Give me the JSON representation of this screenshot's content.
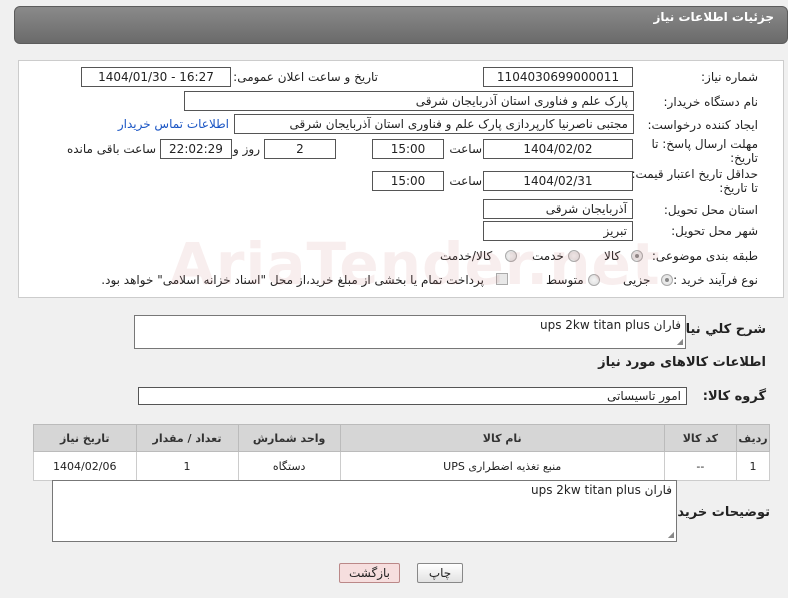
{
  "header": {
    "title": "جزئیات اطلاعات نیاز"
  },
  "form": {
    "need_number": {
      "label": "شماره نیاز:",
      "value": "1104030699000011"
    },
    "announce_datetime": {
      "label": "تاریخ و ساعت اعلان عمومی:",
      "value": "1404/01/30 - 16:27"
    },
    "buyer_org": {
      "label": "نام دستگاه خریدار:",
      "value": "پارک علم و فناوری استان آذربایجان شرقی"
    },
    "requester": {
      "label": "ایجاد کننده درخواست:",
      "value": "مجتبی ناصرنیا کارپردازی پارک علم و فناوری استان آذربایجان شرقی",
      "contact_link": "اطلاعات تماس خریدار"
    },
    "response_deadline": {
      "label_line1": "مهلت ارسال پاسخ: تا",
      "label_line2": "تاریخ:",
      "date": "1404/02/02",
      "time_label": "ساعت",
      "time": "15:00",
      "days": "2",
      "days_label": "روز و",
      "remaining": "22:02:29",
      "remaining_label": "ساعت باقی مانده"
    },
    "price_validity": {
      "label_line1": "حداقل تاریخ اعتبار قیمت:",
      "label_line2": "تا تاریخ:",
      "date": "1404/02/31",
      "time_label": "ساعت",
      "time": "15:00"
    },
    "delivery_province": {
      "label": "استان محل تحویل:",
      "value": "آذربایجان شرقی"
    },
    "delivery_city": {
      "label": "شهر محل تحویل:",
      "value": "تبریز"
    },
    "category": {
      "label": "طبقه بندی موضوعی:",
      "options": [
        "کالا",
        "خدمت",
        "کالا/خدمت"
      ],
      "selected": "کالا"
    },
    "process_type": {
      "label": "نوع فرآیند خرید :",
      "options": [
        "جزیی",
        "متوسط"
      ],
      "selected": "جزیی",
      "note": "پرداخت تمام یا بخشی از مبلغ خرید،از محل \"اسناد خزانه اسلامی\" خواهد بود."
    }
  },
  "description": {
    "label": "شرح کلي نياز:",
    "value": "ups 2kw titan plus فاران"
  },
  "goods_section_title": "اطلاعات کالاهای مورد نیاز",
  "goods_group": {
    "label": "گروه کالا:",
    "value": "امور تاسیساتی"
  },
  "table": {
    "headers": [
      "ردیف",
      "کد کالا",
      "نام کالا",
      "واحد شمارش",
      "تعداد / مقدار",
      "تاریخ نیاز"
    ],
    "rows": [
      [
        "1",
        "--",
        "منبع تغذیه اضطراری UPS",
        "دستگاه",
        "1",
        "1404/02/06"
      ]
    ]
  },
  "buyer_notes": {
    "label": "توضیحات خریدار:",
    "value": "ups 2kw titan plus فاران"
  },
  "buttons": {
    "print": "چاپ",
    "back": "بازگشت"
  },
  "watermark": "AriaTender.net",
  "colors": {
    "header_bg": "#7a7a7a",
    "link": "#1a55c4",
    "back_button_bg": "#f6dede"
  }
}
